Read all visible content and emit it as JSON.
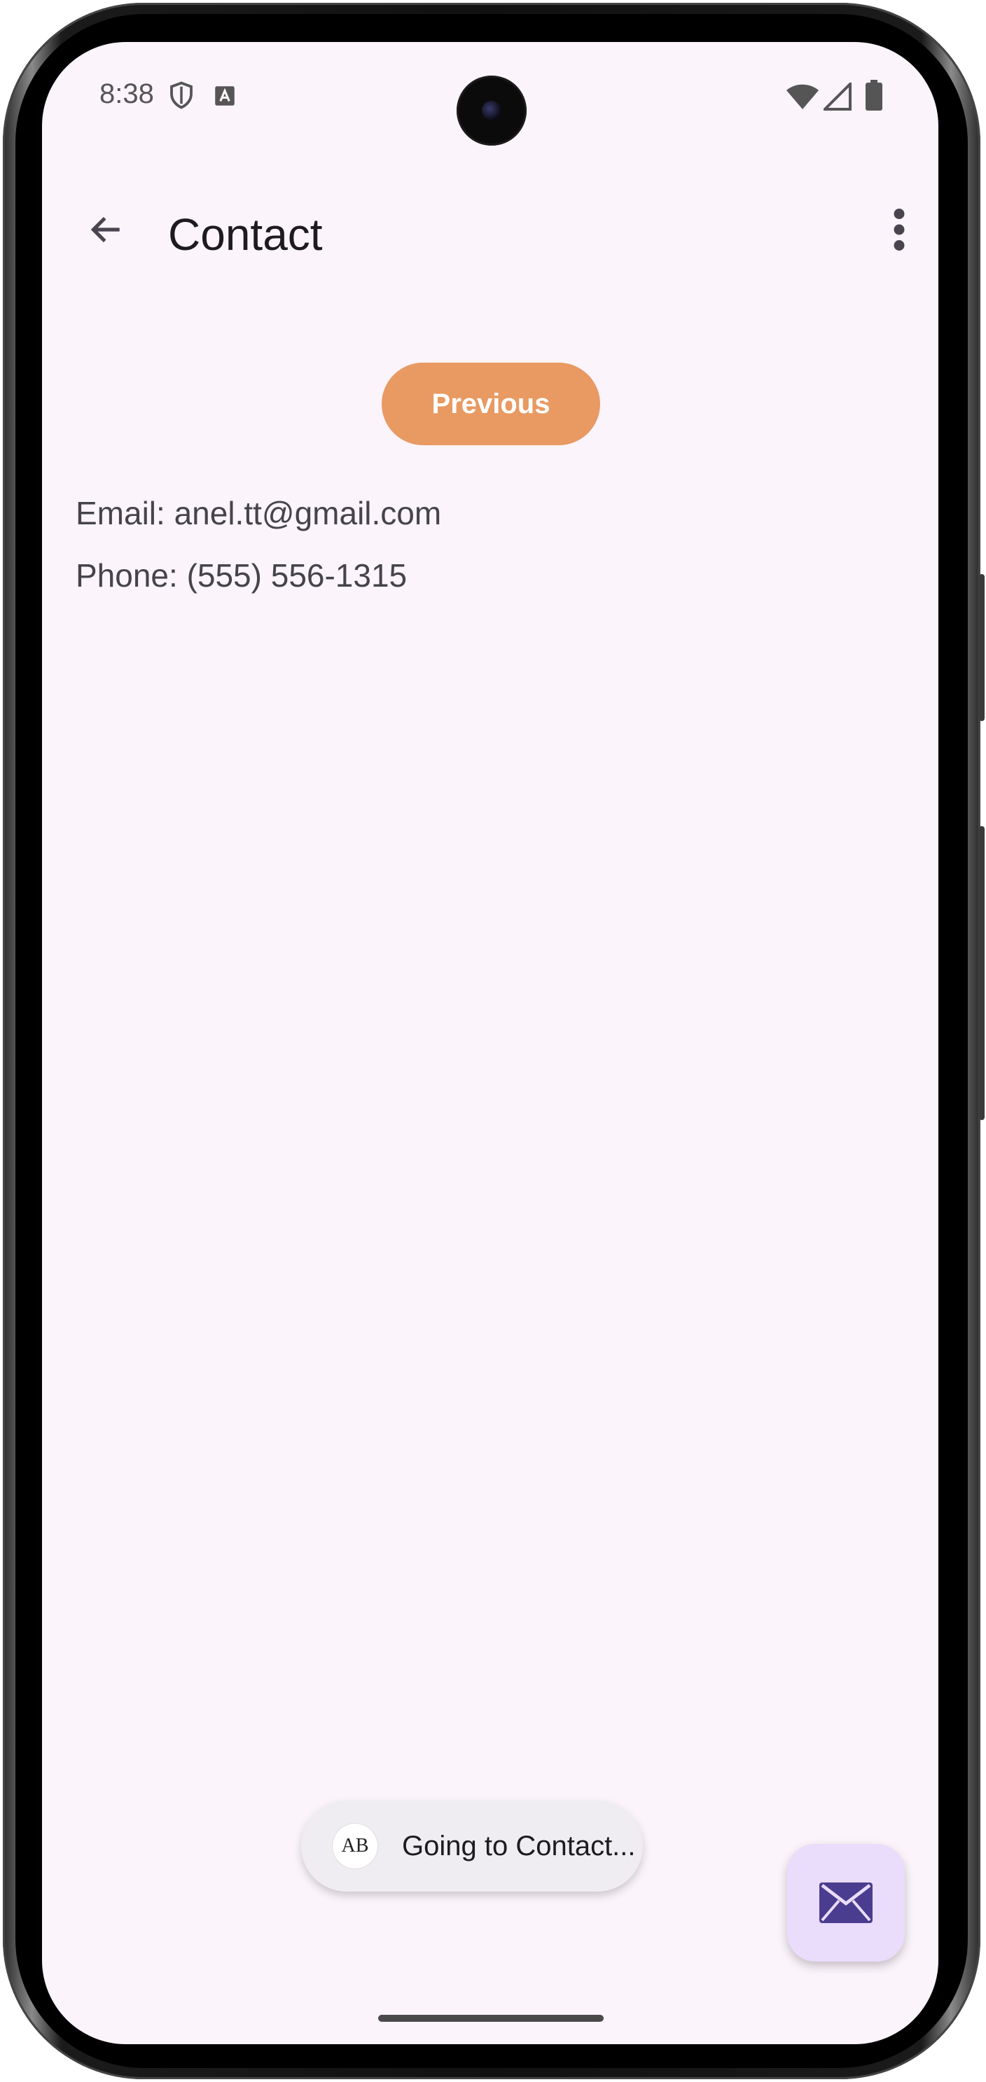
{
  "status_bar": {
    "time": "8:38",
    "left_icons": [
      "shield-icon",
      "font-a-icon"
    ],
    "right_icons": [
      "wifi-icon",
      "signal-icon",
      "battery-icon"
    ]
  },
  "app_bar": {
    "title": "Contact",
    "back_icon": "arrow-left-icon",
    "menu_icon": "more-vert-icon"
  },
  "content": {
    "previous_label": "Previous",
    "email": "Email: anel.tt@gmail.com",
    "phone": "Phone: (555) 556-1315"
  },
  "toast": {
    "app_badge": "AB",
    "message": "Going to Contact..."
  },
  "fab": {
    "icon": "email-icon"
  },
  "colors": {
    "screen_bg": "#fbf4fb",
    "previous_button": "#e89a62",
    "fab_bg": "#eadcfb",
    "fab_icon": "#4a3d8f"
  }
}
